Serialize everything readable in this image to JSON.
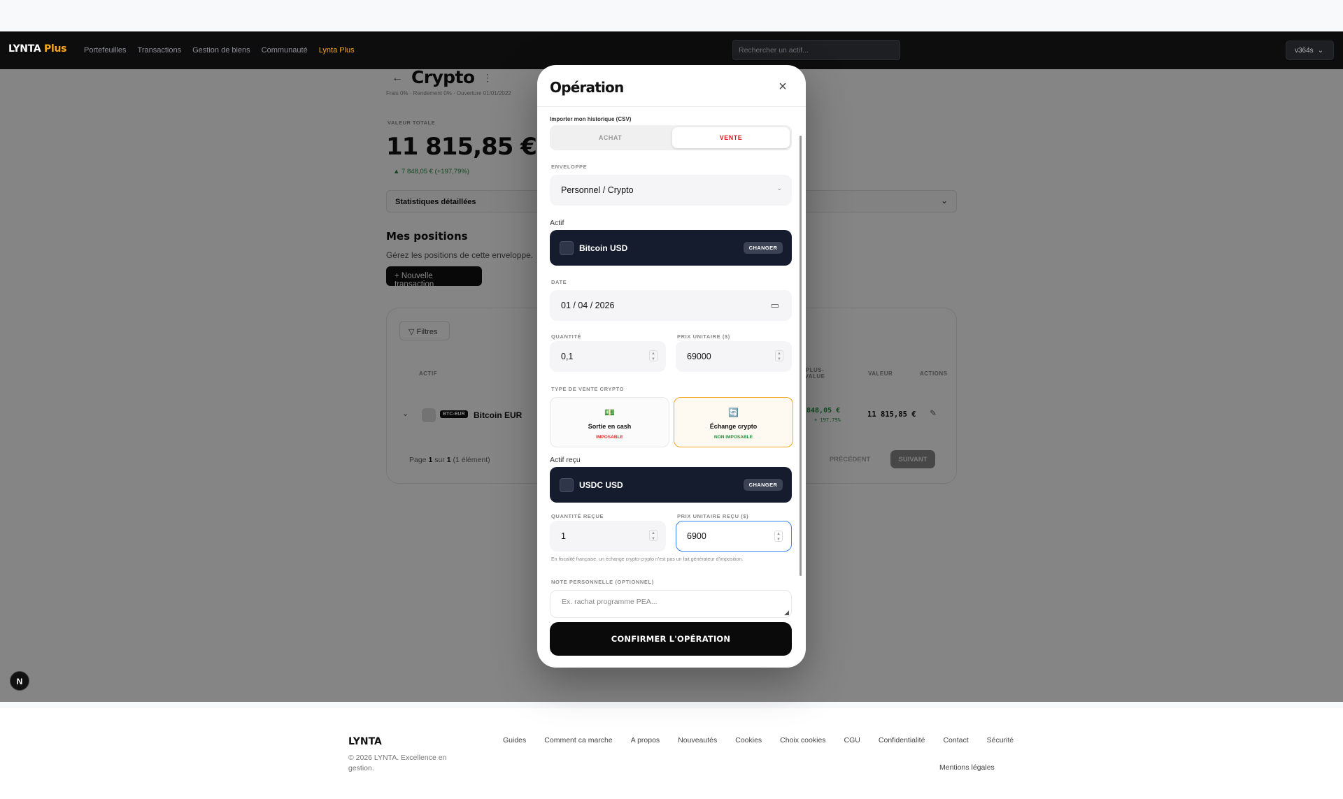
{
  "nav": {
    "brand": "LYNTA",
    "brand_plus": "Plus",
    "links": [
      "Portefeuilles",
      "Transactions",
      "Gestion de biens",
      "Communauté",
      "Lynta Plus"
    ],
    "search_placeholder": "Rechercher un actif...",
    "user": "v364s"
  },
  "page": {
    "title": "Crypto",
    "subtitle": "Frais 0% · Rendement 0% · Ouverture 01/01/2022",
    "total_label": "VALEUR TOTALE",
    "total_value": "11 815,85 €",
    "total_change": "▲ 7 848,05 € (+197,79%)",
    "stats_label": "Statistiques détaillées",
    "positions_title": "Mes positions",
    "positions_desc": "Gérez les positions de cette enveloppe.",
    "new_transaction": "+ Nouvelle transaction",
    "filters": "Filtres",
    "columns": {
      "actif": "ACTIF",
      "plus_value": "PLUS-VALUE",
      "valeur": "VALEUR",
      "actions": "ACTIONS"
    },
    "row": {
      "tag": "BTC-EUR",
      "name": "Bitcoin EUR",
      "plus_value": "848,05 €",
      "plus_value_pct": "+ 197,79%",
      "value": "11 815,85 €"
    },
    "pager": {
      "prefix": "Page",
      "page": "1",
      "of": "sur",
      "total": "1",
      "count": "(1 élément)",
      "prev": "PRÉCÉDENT",
      "next": "SUIVANT"
    }
  },
  "dev_badge": "N",
  "footer": {
    "brand": "LYNTA",
    "copy": "© 2026 LYNTA. Excellence en gestion.",
    "links": [
      "Guides",
      "Comment ca marche",
      "A propos",
      "Nouveautés",
      "Cookies",
      "Choix cookies",
      "CGU",
      "Confidentialité",
      "Contact",
      "Sécurité"
    ],
    "legal": "Mentions légales"
  },
  "modal": {
    "title": "Opération",
    "import_label": "Importer mon historique (CSV)",
    "tab_buy": "ACHAT",
    "tab_sell": "VENTE",
    "envelope_label": "ENVELOPPE",
    "envelope_value": "Personnel / Crypto",
    "asset_label": "Actif",
    "asset_name": "Bitcoin USD",
    "change_label": "CHANGER",
    "date_label": "DATE",
    "date_value": "01 / 04 / 2026",
    "qty_label": "QUANTITÉ",
    "qty_value": "0,1",
    "price_label": "PRIX UNITAIRE ($)",
    "price_value": "69000",
    "sale_type_label": "TYPE DE VENTE CRYPTO",
    "type_cash_name": "Sortie en cash",
    "type_cash_sub": "IMPOSABLE",
    "type_swap_name": "Échange crypto",
    "type_swap_sub": "NON IMPOSABLE",
    "received_asset_label": "Actif reçu",
    "received_asset_name": "USDC USD",
    "received_qty_label": "QUANTITÉ REÇUE",
    "received_qty_value": "1",
    "received_price_label": "PRIX UNITAIRE REÇU ($)",
    "received_price_value": "6900",
    "tax_note": "En fiscalité française, un échange crypto-crypto n'est pas un fait générateur d'imposition.",
    "note_label": "NOTE PERSONNELLE (OPTIONNEL)",
    "note_placeholder": "Ex. rachat programme PEA...",
    "confirm": "CONFIRMER L'OPÉRATION"
  },
  "colors": {
    "accent": "#f5a623",
    "sell": "#d32222",
    "positive": "#1e8f3c",
    "focus": "#3b82f6",
    "dark_card": "#141c2e"
  }
}
